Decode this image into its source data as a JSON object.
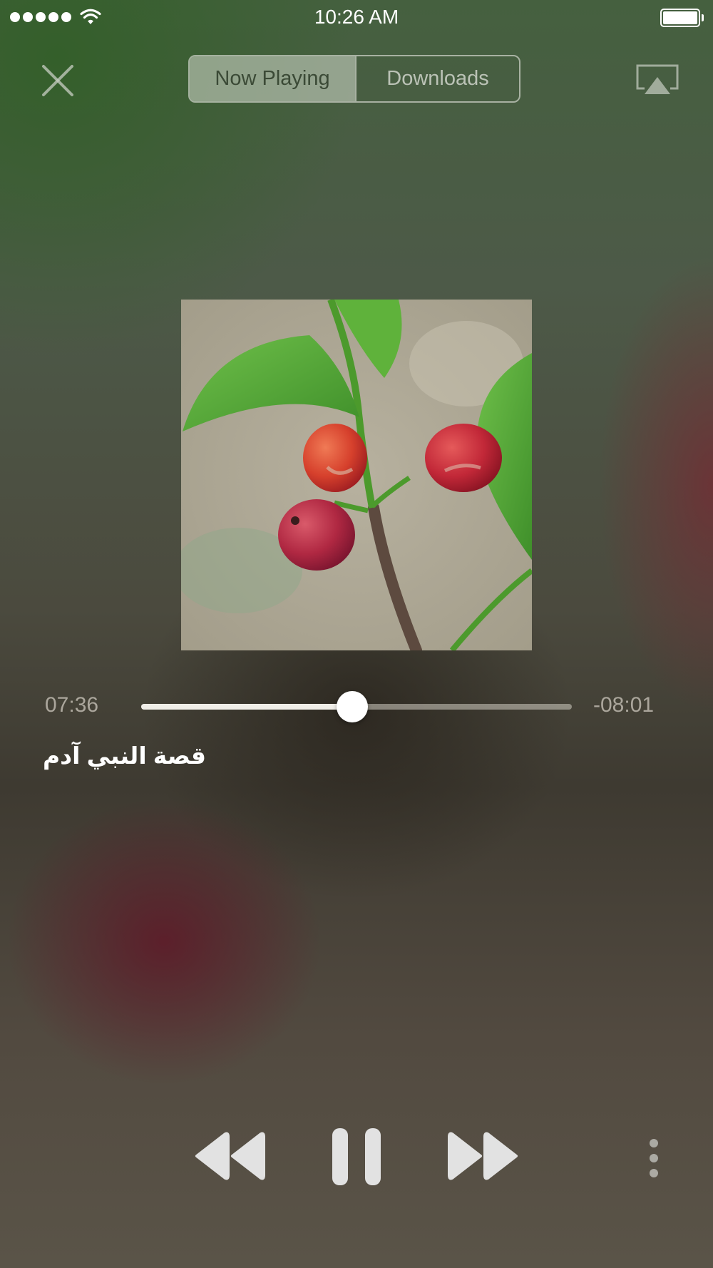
{
  "status_bar": {
    "time": "10:26 AM",
    "signal_bars": 5,
    "battery_level": 1.0
  },
  "header": {
    "close_icon": "close-icon",
    "tabs": [
      {
        "label": "Now Playing",
        "selected": true
      },
      {
        "label": "Downloads",
        "selected": false
      }
    ],
    "airplay_icon": "airplay-icon"
  },
  "player": {
    "artwork": "coffee-berries-photo",
    "elapsed": "07:36",
    "remaining": "-08:01",
    "progress_fraction": 0.49,
    "track_title": "قصة النبي آدم"
  },
  "controls": {
    "rewind_icon": "rewind-icon",
    "pause_icon": "pause-icon",
    "forward_icon": "fast-forward-icon",
    "more_icon": "more-vertical-icon"
  },
  "colors": {
    "accent_text": "#ffffff",
    "segment_active_bg": "#bec8b9",
    "control_fill": "#e2e2e2"
  }
}
